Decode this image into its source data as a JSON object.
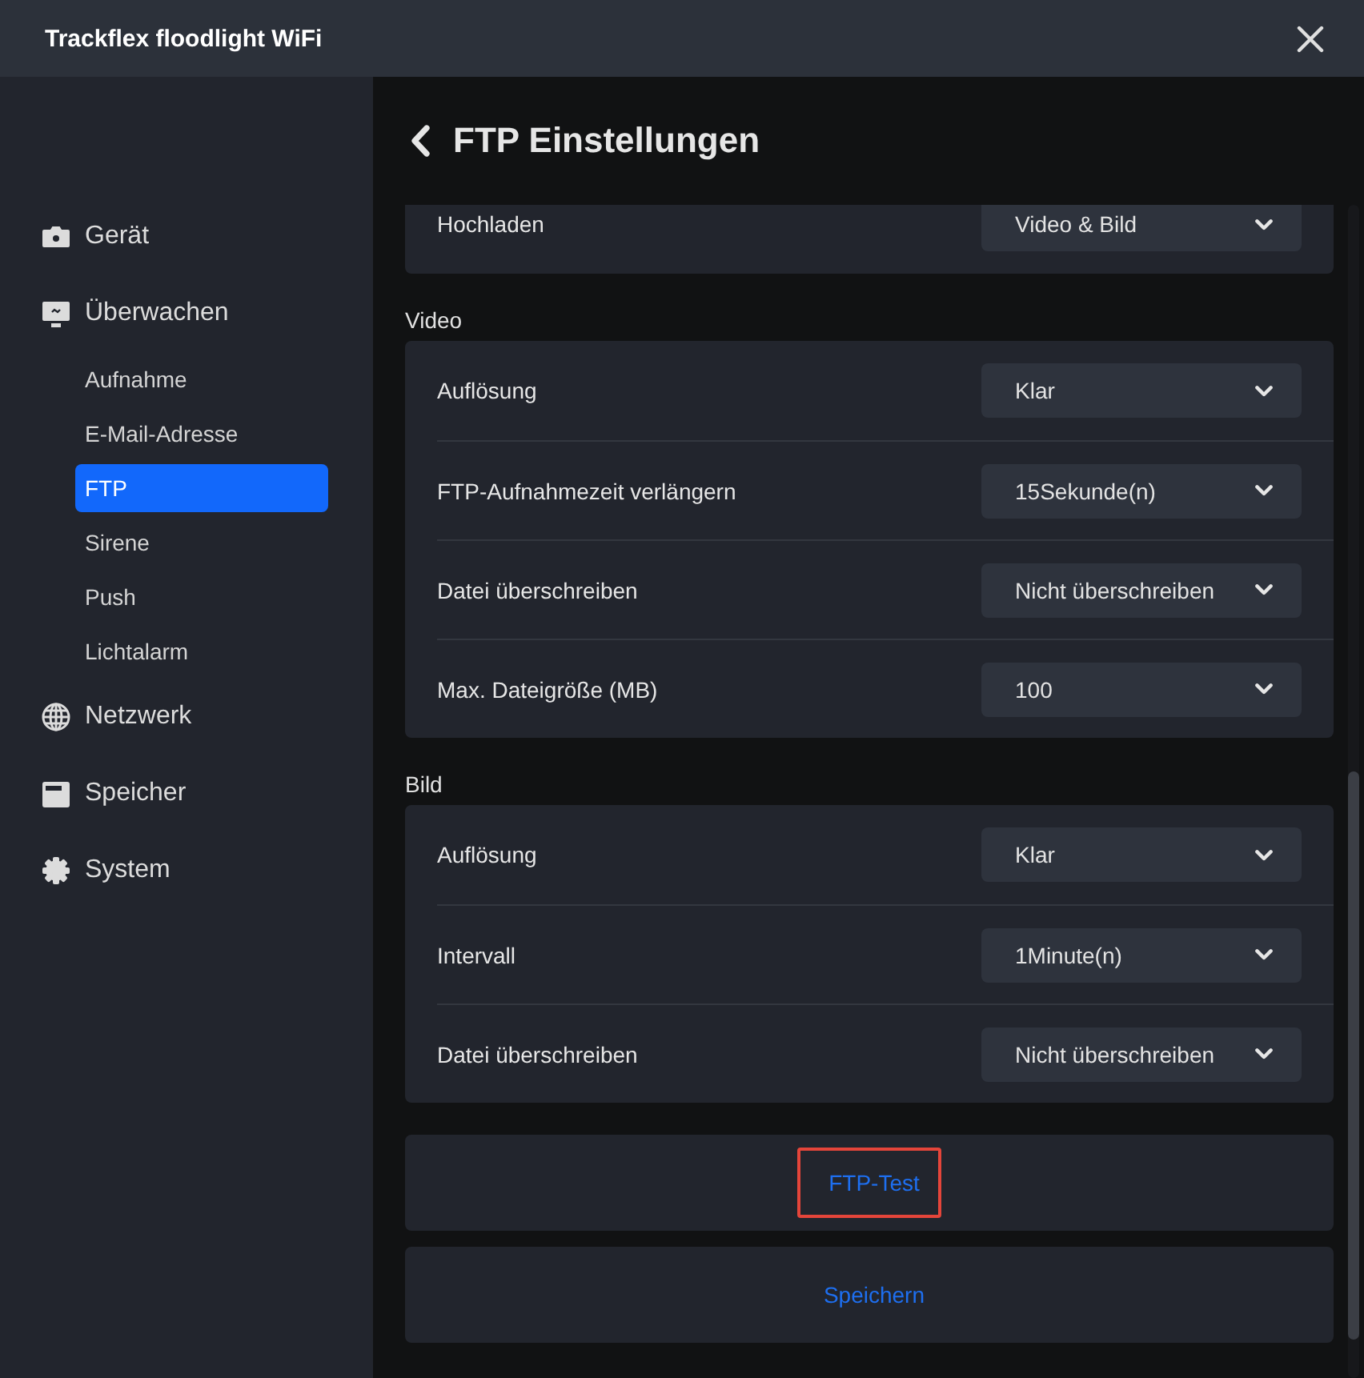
{
  "window": {
    "title": "Trackflex floodlight WiFi"
  },
  "sidebar": {
    "items": [
      {
        "label": "Gerät"
      },
      {
        "label": "Überwachen",
        "children": [
          {
            "label": "Aufnahme",
            "selected": false
          },
          {
            "label": "E-Mail-Adresse",
            "selected": false
          },
          {
            "label": "FTP",
            "selected": true
          },
          {
            "label": "Sirene",
            "selected": false
          },
          {
            "label": "Push",
            "selected": false
          },
          {
            "label": "Lichtalarm",
            "selected": false
          }
        ]
      },
      {
        "label": "Netzwerk"
      },
      {
        "label": "Speicher"
      },
      {
        "label": "System"
      }
    ]
  },
  "page": {
    "title": "FTP Einstellungen"
  },
  "sections": [
    {
      "rows": [
        {
          "label": "Hochladen",
          "value": "Video & Bild"
        }
      ]
    },
    {
      "heading": "Video",
      "rows": [
        {
          "label": "Auflösung",
          "value": "Klar"
        },
        {
          "label": "FTP-Aufnahmezeit verlängern",
          "value": "15Sekunde(n)"
        },
        {
          "label": "Datei überschreiben",
          "value": "Nicht überschreiben"
        },
        {
          "label": "Max. Dateigröße (MB)",
          "value": "100"
        }
      ]
    },
    {
      "heading": "Bild",
      "rows": [
        {
          "label": "Auflösung",
          "value": "Klar"
        },
        {
          "label": "Intervall",
          "value": "1Minute(n)"
        },
        {
          "label": "Datei überschreiben",
          "value": "Nicht überschreiben"
        }
      ]
    }
  ],
  "actions": [
    {
      "label": "FTP-Test",
      "highlighted": true
    },
    {
      "label": "Speichern",
      "highlighted": false
    }
  ]
}
